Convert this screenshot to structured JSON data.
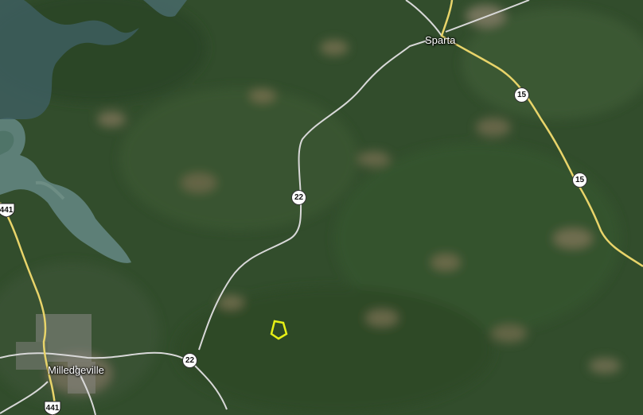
{
  "map": {
    "view": "satellite",
    "colors": {
      "forest": "#2f4a2a",
      "water": "#5d7f77",
      "state_route": "#e8d46a",
      "local_road": "#d8d8d8",
      "parcel_outline": "#e6f016"
    },
    "places": [
      {
        "name": "Sparta"
      },
      {
        "name": "Milledgeville"
      }
    ],
    "route_shields": [
      {
        "number": "15",
        "kind": "state"
      },
      {
        "number": "15",
        "kind": "state"
      },
      {
        "number": "22",
        "kind": "state"
      },
      {
        "number": "22",
        "kind": "state"
      },
      {
        "number": "441",
        "kind": "us"
      },
      {
        "number": "441",
        "kind": "us"
      }
    ]
  }
}
